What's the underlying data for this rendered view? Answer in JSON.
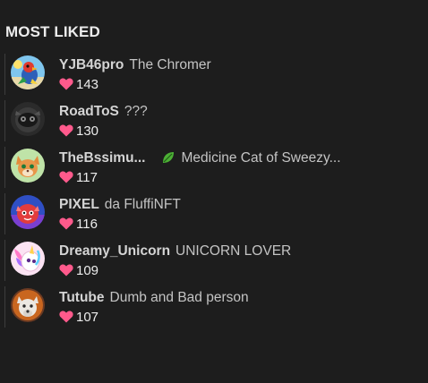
{
  "section": {
    "title": "MOST LIKED"
  },
  "colors": {
    "background": "#1d1d1d",
    "heart": "#ff5a8c",
    "username": "#d4d4d4",
    "bio": "#c4c4c4"
  },
  "users": [
    {
      "username": "YJB46pro",
      "bio": "The Chromer",
      "likes": "143",
      "avatar": "parrot-avatar",
      "bio_icon": ""
    },
    {
      "username": "RoadToS",
      "bio": "???",
      "likes": "130",
      "avatar": "dark-creature-avatar",
      "bio_icon": ""
    },
    {
      "username": "TheBssimu...",
      "bio": "Medicine Cat of Sweezy...",
      "likes": "117",
      "avatar": "cat-avatar",
      "bio_icon": "leaf-icon"
    },
    {
      "username": "PIXEL",
      "bio": "da FluffiNFT",
      "likes": "116",
      "avatar": "fluffy-avatar",
      "bio_icon": ""
    },
    {
      "username": "Dreamy_Unicorn",
      "bio": "UNICORN LOVER",
      "likes": "109",
      "avatar": "unicorn-avatar",
      "bio_icon": ""
    },
    {
      "username": "Tutube",
      "bio": "Dumb and Bad person",
      "likes": "107",
      "avatar": "wolf-avatar",
      "bio_icon": ""
    }
  ]
}
